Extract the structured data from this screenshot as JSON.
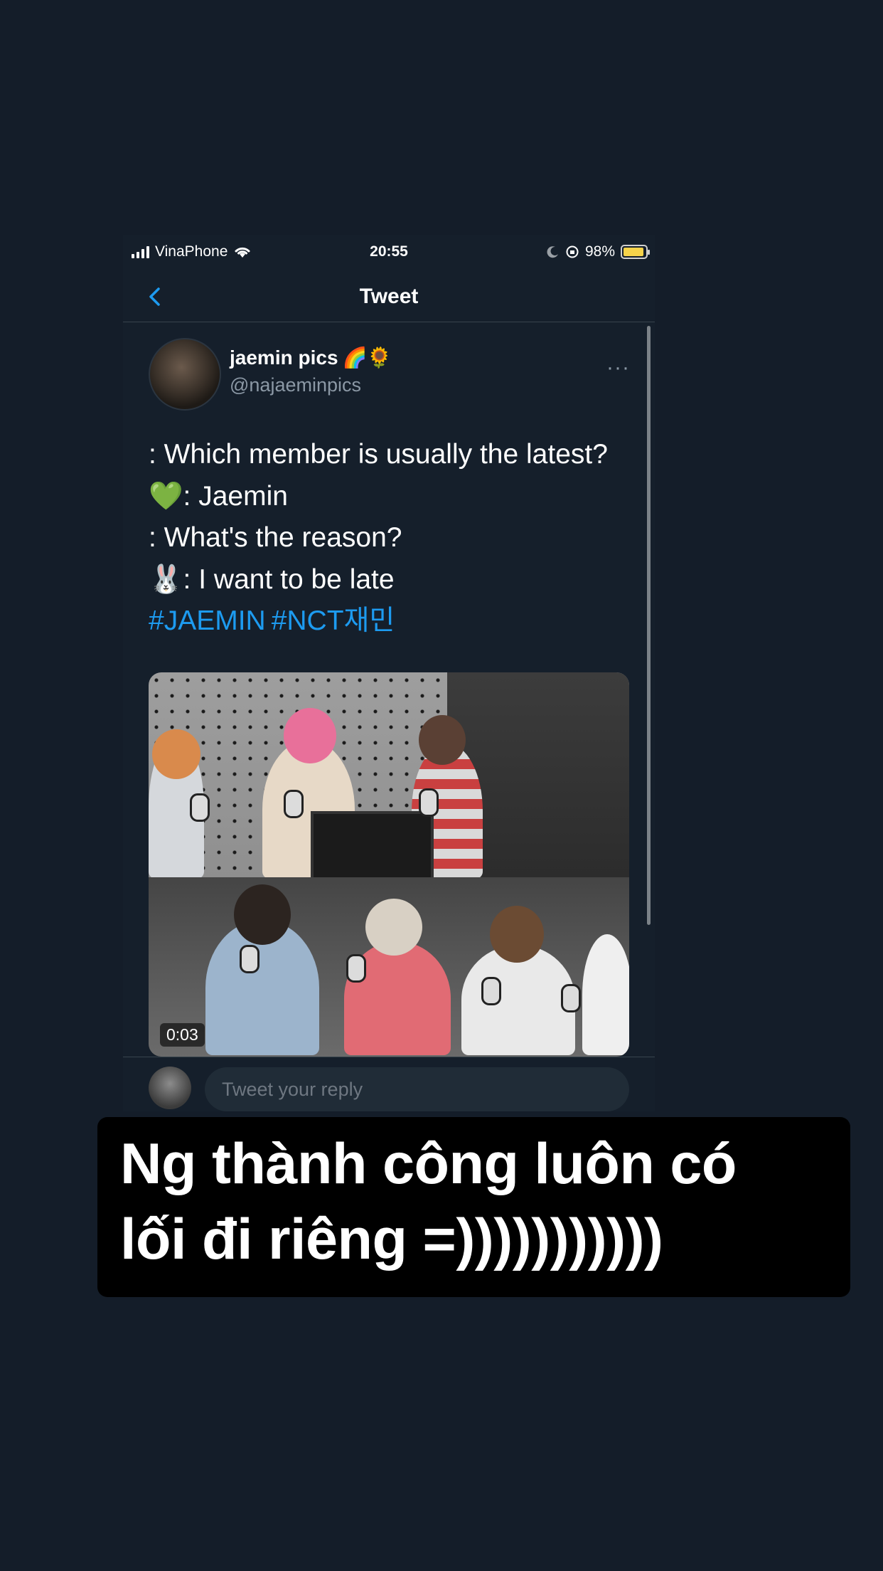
{
  "status_bar": {
    "carrier": "VinaPhone",
    "time": "20:55",
    "battery": "98%"
  },
  "header": {
    "title": "Tweet"
  },
  "tweet": {
    "author_name": "jaemin pics",
    "author_emoji": "🌈🌻",
    "handle": "@najaeminpics",
    "more": "···",
    "lines": [
      ": Which member is usually the latest?",
      "💚: Jaemin",
      " : What's the reason?",
      "🐰: I want to be late"
    ],
    "hashtags": [
      "#JAEMIN",
      "#NCT재민"
    ],
    "media": {
      "duration": "0:03"
    }
  },
  "reply": {
    "placeholder": "Tweet your reply"
  },
  "caption": {
    "line1": "Ng thành công luôn có",
    "line2": "lối đi riêng =)))))))))))"
  },
  "colors": {
    "background": "#141d29",
    "accent": "#1d9bf0",
    "muted": "#8b98a5"
  }
}
